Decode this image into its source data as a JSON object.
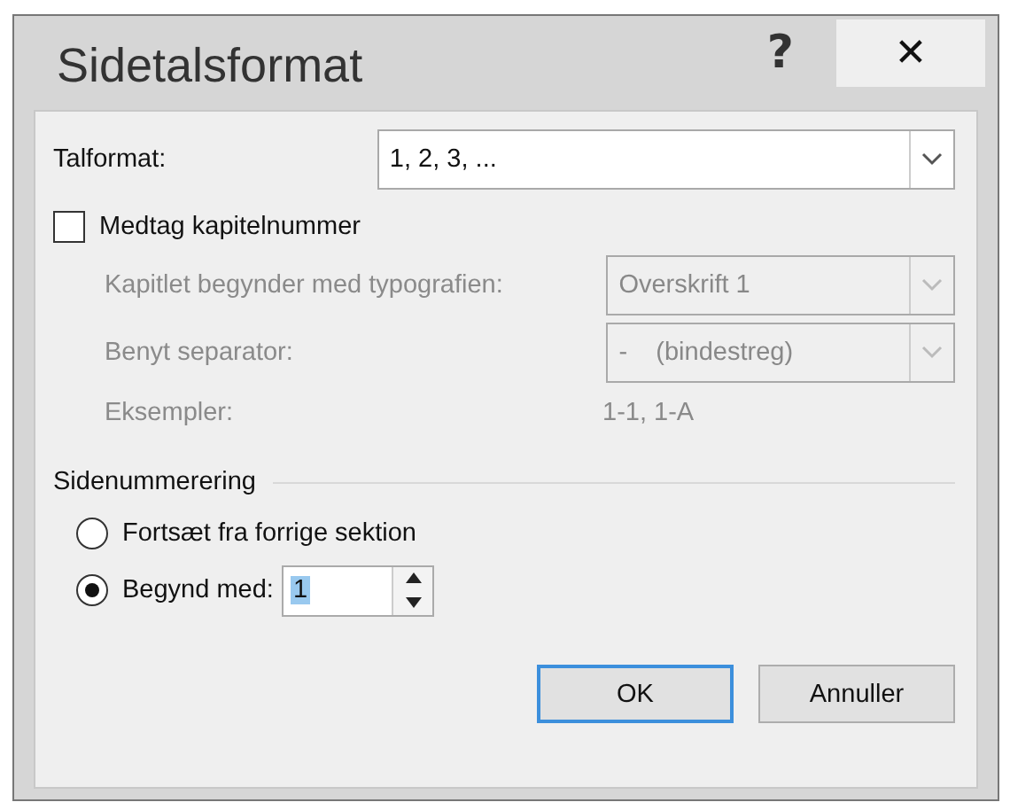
{
  "window": {
    "title": "Sidetalsformat",
    "help": "?",
    "close": "✕"
  },
  "number_format": {
    "label": "Talformat:",
    "value": "1, 2, 3, ..."
  },
  "include_chapter": {
    "label": "Medtag kapitelnummer",
    "checked": false
  },
  "chapter_fields": [
    {
      "kind": "combo",
      "label": "Kapitlet begynder med typografien:",
      "value": "Overskrift 1",
      "disabled": true
    },
    {
      "kind": "combo",
      "label": "Benyt separator:",
      "value": "-    (bindestreg)",
      "disabled": true
    },
    {
      "kind": "text",
      "label": "Eksempler:",
      "value": "1-1, 1-A",
      "disabled": true
    }
  ],
  "page_numbering": {
    "legend": "Sidenummerering",
    "options": [
      {
        "label": "Fortsæt fra forrige sektion",
        "selected": false
      },
      {
        "label": "Begynd med:",
        "selected": true,
        "value": "1",
        "value_highlighted": true
      }
    ]
  },
  "buttons": [
    {
      "label": "OK",
      "default": true
    },
    {
      "label": "Annuller",
      "default": false
    }
  ]
}
